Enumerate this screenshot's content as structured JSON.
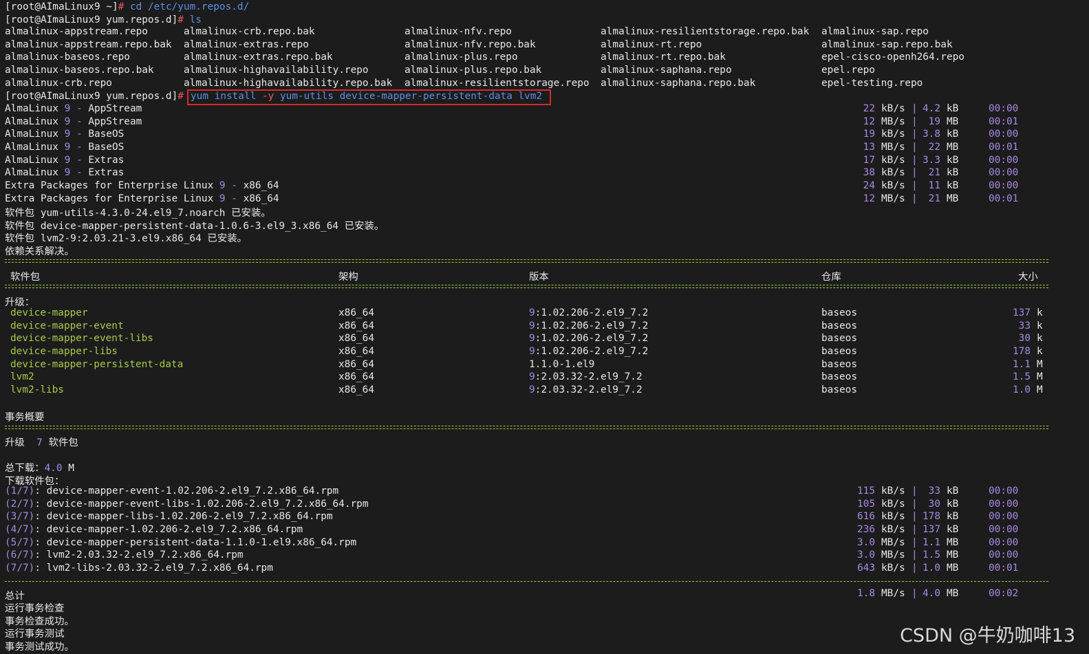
{
  "prompt1": {
    "user": "[root@AImaLinux9 ~]",
    "hash": "#",
    "cmd": " cd /etc/yum.repos.d/"
  },
  "prompt2": {
    "user": "[root@AImaLinux9 yum.repos.d]",
    "hash": "#",
    "cmd": " ls"
  },
  "ls_rows": [
    [
      "almalinux-appstream.repo",
      "almalinux-crb.repo.bak",
      "almalinux-nfv.repo",
      "almalinux-resilientstorage.repo.bak",
      "almalinux-sap.repo"
    ],
    [
      "almalinux-appstream.repo.bak",
      "almalinux-extras.repo",
      "almalinux-nfv.repo.bak",
      "almalinux-rt.repo",
      "almalinux-sap.repo.bak"
    ],
    [
      "almalinux-baseos.repo",
      "almalinux-extras.repo.bak",
      "almalinux-plus.repo",
      "almalinux-rt.repo.bak",
      "epel-cisco-openh264.repo"
    ],
    [
      "almalinux-baseos.repo.bak",
      "almalinux-highavailability.repo",
      "almalinux-plus.repo.bak",
      "almalinux-saphana.repo",
      "epel.repo"
    ],
    [
      "almalinux-crb.repo",
      "almalinux-highavailability.repo.bak",
      "almalinux-resilientstorage.repo",
      "almalinux-saphana.repo.bak",
      "epel-testing.repo"
    ]
  ],
  "prompt3": {
    "user": "[root@AImaLinux9 yum.repos.d]",
    "hash": "#",
    "cmd_a": "yum install ",
    "cmd_flag": "-y",
    "cmd_b": " yum-utils device-mapper-persistent-data lvm2"
  },
  "repos": [
    {
      "pre": "AlmaLinux ",
      "num": "9",
      "mid": " - ",
      "name": "AppStream",
      "rate": "22",
      "rate_u": "kB/s",
      "size": "4.2",
      "size_u": "kB",
      "time": "00:00"
    },
    {
      "pre": "AlmaLinux ",
      "num": "9",
      "mid": " - ",
      "name": "AppStream",
      "rate": "12",
      "rate_u": "MB/s",
      "size": "19",
      "size_u": "MB",
      "time": "00:01"
    },
    {
      "pre": "AlmaLinux ",
      "num": "9",
      "mid": " - ",
      "name": "BaseOS",
      "rate": "19",
      "rate_u": "kB/s",
      "size": "3.8",
      "size_u": "kB",
      "time": "00:00"
    },
    {
      "pre": "AlmaLinux ",
      "num": "9",
      "mid": " - ",
      "name": "BaseOS",
      "rate": "13",
      "rate_u": "MB/s",
      "size": "22",
      "size_u": "MB",
      "time": "00:01"
    },
    {
      "pre": "AlmaLinux ",
      "num": "9",
      "mid": " - ",
      "name": "Extras",
      "rate": "17",
      "rate_u": "kB/s",
      "size": "3.3",
      "size_u": "kB",
      "time": "00:00"
    },
    {
      "pre": "AlmaLinux ",
      "num": "9",
      "mid": " - ",
      "name": "Extras",
      "rate": "38",
      "rate_u": "kB/s",
      "size": "21",
      "size_u": "kB",
      "time": "00:00"
    },
    {
      "pre": "Extra Packages for Enterprise Linux ",
      "num": "9",
      "mid": " - ",
      "name": "x86_64",
      "rate": "24",
      "rate_u": "kB/s",
      "size": "11",
      "size_u": "kB",
      "time": "00:00"
    },
    {
      "pre": "Extra Packages for Enterprise Linux ",
      "num": "9",
      "mid": " - ",
      "name": "x86_64",
      "rate": "12",
      "rate_u": "MB/s",
      "size": "21",
      "size_u": "MB",
      "time": "00:01"
    }
  ],
  "installed": [
    "软件包 yum-utils-4.3.0-24.el9_7.noarch 已安装。",
    "软件包 device-mapper-persistent-data-1.0.6-3.el9_3.x86_64 已安装。",
    "软件包 lvm2-9:2.03.21-3.el9.x86_64 已安装。",
    "依赖关系解决。"
  ],
  "table_header": {
    "pkg": "软件包",
    "arch": "架构",
    "ver": "版本",
    "repo": "仓库",
    "size": "大小"
  },
  "upgrade_label": "升级：",
  "packages": [
    {
      "name": "device-mapper",
      "arch": "x86_64",
      "epoch": "9",
      "ver": ":1.02.206-2.el9_7.2",
      "repo": "baseos",
      "size": "137",
      "unit": "k"
    },
    {
      "name": "device-mapper-event",
      "arch": "x86_64",
      "epoch": "9",
      "ver": ":1.02.206-2.el9_7.2",
      "repo": "baseos",
      "size": "33",
      "unit": "k"
    },
    {
      "name": "device-mapper-event-libs",
      "arch": "x86_64",
      "epoch": "9",
      "ver": ":1.02.206-2.el9_7.2",
      "repo": "baseos",
      "size": "30",
      "unit": "k"
    },
    {
      "name": "device-mapper-libs",
      "arch": "x86_64",
      "epoch": "9",
      "ver": ":1.02.206-2.el9_7.2",
      "repo": "baseos",
      "size": "178",
      "unit": "k"
    },
    {
      "name": "device-mapper-persistent-data",
      "arch": "x86_64",
      "epoch": "",
      "ver": "1.1.0-1.el9",
      "repo": "baseos",
      "size": "1.1",
      "unit": "M"
    },
    {
      "name": "lvm2",
      "arch": "x86_64",
      "epoch": "9",
      "ver": ":2.03.32-2.el9_7.2",
      "repo": "baseos",
      "size": "1.5",
      "unit": "M"
    },
    {
      "name": "lvm2-libs",
      "arch": "x86_64",
      "epoch": "9",
      "ver": ":2.03.32-2.el9_7.2",
      "repo": "baseos",
      "size": "1.0",
      "unit": "M"
    }
  ],
  "summary_title": "事务概要",
  "summary_line": {
    "a": "升级  ",
    "n": "7",
    "b": " 软件包"
  },
  "total_download": {
    "label": "总下载：",
    "value": "4.0",
    "unit": " M"
  },
  "downloading_label": "下载软件包：",
  "downloads": [
    {
      "idx": "(1/7)",
      "file": ": device-mapper-event-1.02.206-2.el9_7.2.x86_64.rpm",
      "rate": "115",
      "rate_u": "kB/s",
      "size": "33",
      "size_u": "kB",
      "time": "00:00"
    },
    {
      "idx": "(2/7)",
      "file": ": device-mapper-event-libs-1.02.206-2.el9_7.2.x86_64.rpm",
      "rate": "105",
      "rate_u": "kB/s",
      "size": "30",
      "size_u": "kB",
      "time": "00:00"
    },
    {
      "idx": "(3/7)",
      "file": ": device-mapper-libs-1.02.206-2.el9_7.2.x86_64.rpm",
      "rate": "616",
      "rate_u": "kB/s",
      "size": "178",
      "size_u": "kB",
      "time": "00:00"
    },
    {
      "idx": "(4/7)",
      "file": ": device-mapper-1.02.206-2.el9_7.2.x86_64.rpm",
      "rate": "236",
      "rate_u": "kB/s",
      "size": "137",
      "size_u": "kB",
      "time": "00:00"
    },
    {
      "idx": "(5/7)",
      "file": ": device-mapper-persistent-data-1.1.0-1.el9.x86_64.rpm",
      "rate": "3.0",
      "rate_u": "MB/s",
      "size": "1.1",
      "size_u": "MB",
      "time": "00:00"
    },
    {
      "idx": "(6/7)",
      "file": ": lvm2-2.03.32-2.el9_7.2.x86_64.rpm",
      "rate": "3.0",
      "rate_u": "MB/s",
      "size": "1.5",
      "size_u": "MB",
      "time": "00:00"
    },
    {
      "idx": "(7/7)",
      "file": ": lvm2-libs-2.03.32-2.el9_7.2.x86_64.rpm",
      "rate": "643",
      "rate_u": "kB/s",
      "size": "1.0",
      "size_u": "MB",
      "time": "00:01"
    }
  ],
  "total": {
    "label": "总计",
    "rate": "1.8",
    "rate_u": "MB/s",
    "size": "4.0",
    "size_u": "MB",
    "time": "00:02"
  },
  "tail": [
    "运行事务检查",
    "事务检查成功。",
    "运行事务测试",
    "事务测试成功。"
  ],
  "pipe": "|",
  "watermark": "CSDN @牛奶咖啡13"
}
